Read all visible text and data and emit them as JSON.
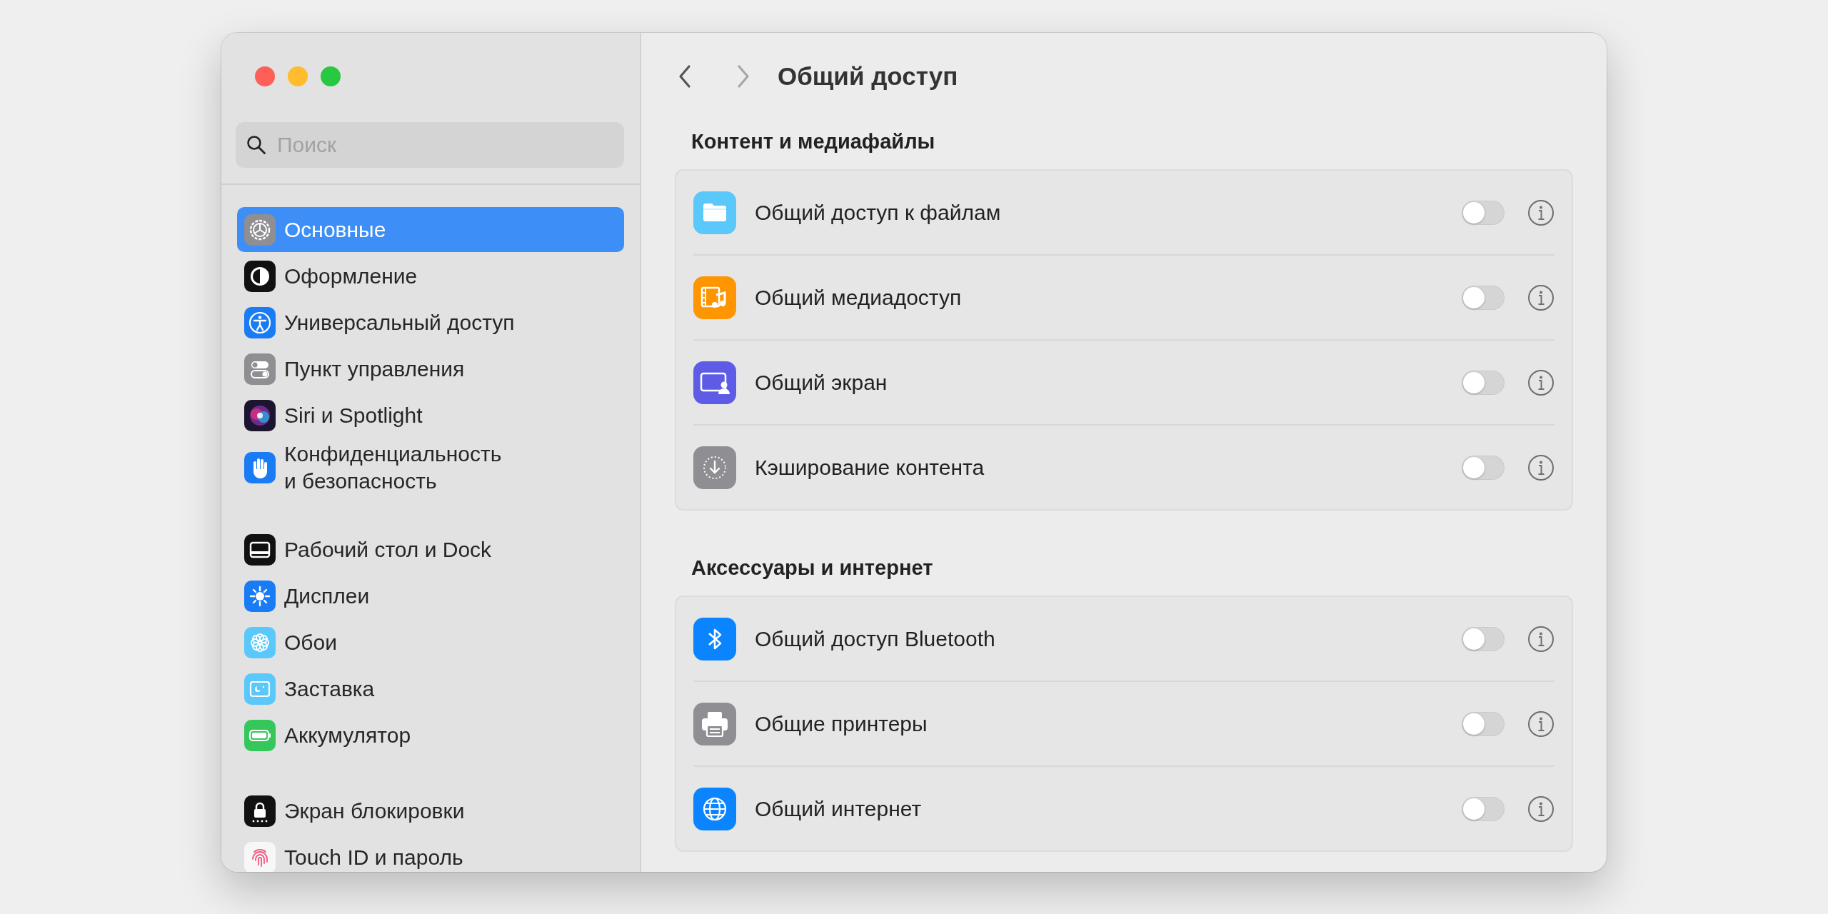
{
  "sidebar": {
    "search": {
      "placeholder": "Поиск"
    },
    "groups": [
      {
        "items": [
          {
            "label": "Основные",
            "selected": true
          },
          {
            "label": "Оформление",
            "selected": false
          },
          {
            "label": "Универсальный доступ",
            "selected": false
          },
          {
            "label": "Пункт управления",
            "selected": false
          },
          {
            "label": "Siri и Spotlight",
            "selected": false
          },
          {
            "label": "Конфиденциальность\nи безопасность",
            "selected": false
          }
        ]
      },
      {
        "items": [
          {
            "label": "Рабочий стол и Dock",
            "selected": false
          },
          {
            "label": "Дисплеи",
            "selected": false
          },
          {
            "label": "Обои",
            "selected": false
          },
          {
            "label": "Заставка",
            "selected": false
          },
          {
            "label": "Аккумулятор",
            "selected": false
          }
        ]
      },
      {
        "items": [
          {
            "label": "Экран блокировки",
            "selected": false
          },
          {
            "label": "Touch ID и пароль",
            "selected": false
          }
        ]
      }
    ]
  },
  "header": {
    "back": {
      "disabled": false
    },
    "forward": {
      "disabled": true
    },
    "title": "Общий доступ"
  },
  "sections": [
    {
      "heading": "Контент и медиафайлы",
      "rows": [
        {
          "label": "Общий доступ к файлам",
          "on": false
        },
        {
          "label": "Общий медиадоступ",
          "on": false
        },
        {
          "label": "Общий экран",
          "on": false
        },
        {
          "label": "Кэширование контента",
          "on": false
        }
      ]
    },
    {
      "heading": "Аксессуары и интернет",
      "rows": [
        {
          "label": "Общий доступ Bluetooth",
          "on": false
        },
        {
          "label": "Общие принтеры",
          "on": false
        },
        {
          "label": "Общий интернет",
          "on": false
        }
      ]
    }
  ]
}
